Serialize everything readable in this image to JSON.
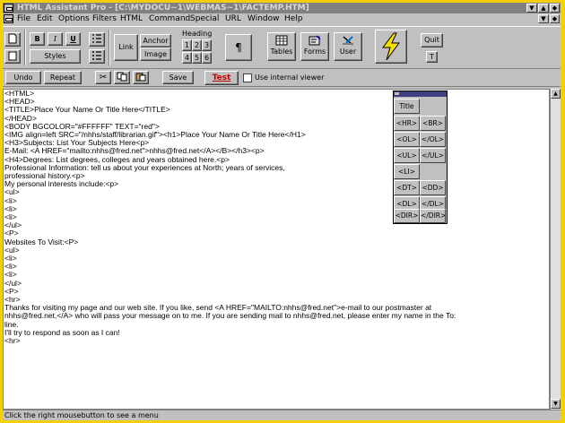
{
  "window": {
    "title": "HTML Assistant Pro - [C:\\MYDOCU~1\\WEBMAS~1\\FACTEMP.HTM]"
  },
  "menu": [
    "File",
    "Edit",
    "Options",
    "Filters",
    "HTML",
    "Command",
    "Special",
    "URL",
    "Window",
    "Help"
  ],
  "toolbar": {
    "bold": "B",
    "italic": "I",
    "underline": "U",
    "styles": "Styles",
    "link": "Link",
    "anchor": "Anchor",
    "image": "Image",
    "heading_label": "Heading",
    "headings": [
      "1",
      "2",
      "3",
      "4",
      "5",
      "6"
    ],
    "paragraph": "¶",
    "tables": "Tables",
    "forms": "Forms",
    "user": "User",
    "quit": "Quit",
    "t_button": "T"
  },
  "toolbar2": {
    "undo": "Undo",
    "repeat": "Repeat",
    "save": "Save",
    "test": "Test",
    "use_internal_viewer": "Use internal viewer",
    "use_internal_viewer_checked": false
  },
  "palette": {
    "title_button": "Title",
    "buttons": [
      [
        "<HR>",
        "<BR>"
      ],
      [
        "<OL>",
        "</OL>"
      ],
      [
        "<UL>",
        "</UL>"
      ],
      [
        "<LI>",
        ""
      ],
      [
        "<DT>",
        "<DD>"
      ],
      [
        "<DL>",
        "</DL>"
      ],
      [
        "<DIR>",
        "</DIR>"
      ]
    ]
  },
  "editor_lines": [
    "<HTML>",
    "<HEAD>",
    "<TITLE>Place Your Name Or Title Here</TITLE>",
    "</HEAD>",
    "<BODY BGCOLOR=\"#FFFFFF\" TEXT=\"red\">",
    "<IMG align=left SRC=\"/nhhs/staff/librarian.gif\"><h1>Place Your Name Or Title Here</H1>",
    "<H3>Subjects: List Your Subjects Here<p>",
    "E-Mail: <A HREF=\"mailto:nhhs@fred.net\">nhhs@fred.net</A></B></h3><p>",
    "<H4>Degrees: List degrees, colleges and years obtained here.<p>",
    "Professional Information: tell us about your experiences at North; years of services,",
    "professional history.<p>",
    "",
    "My personal interests include:<p>",
    "",
    "<ul>",
    "<li>",
    "<li>",
    "<li>",
    "</ul>",
    "<P>",
    "",
    "Websites To Visit:<P>",
    "<ul>",
    "<li>",
    "<li>",
    "<li>",
    "</ul>",
    "<P>",
    "",
    "<hr>",
    "Thanks for visiting my page and our web site. If you like, send <A HREF=\"MAILTO:nhhs@fred.net\">e-mail to our postmaster at",
    "nhhs@fred.net,</A> who will pass your message on to me. If you are sending mail to nhhs@fred.net, please enter my name in the To:",
    "line.",
    "I'll try to respond as soon as I can!",
    "<hr>"
  ],
  "status": "Click the right mousebutton to see a menu",
  "colors": {
    "outer_border": "#f5d000",
    "window_face": "#c0c0c0",
    "editor_bg": "#ffffff",
    "test_text": "#c00000",
    "lightning": "#f5e000"
  }
}
